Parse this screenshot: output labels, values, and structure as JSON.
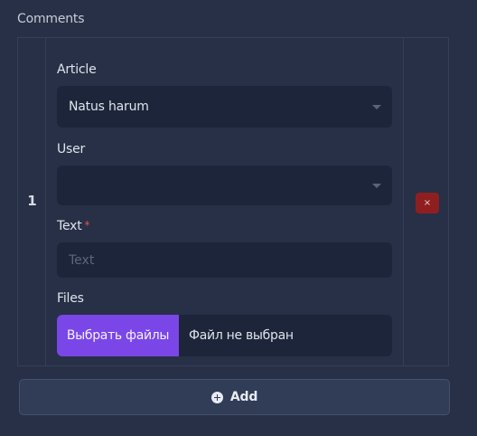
{
  "section": {
    "title": "Comments"
  },
  "row": {
    "index": "1",
    "article": {
      "label": "Article",
      "value": "Natus harum"
    },
    "user": {
      "label": "User",
      "value": ""
    },
    "text": {
      "label": "Text",
      "required_mark": "*",
      "placeholder": "Text",
      "value": ""
    },
    "files": {
      "label": "Files",
      "button_label": "Выбрать файлы",
      "status": "Файл не выбран"
    },
    "delete_label": "×"
  },
  "add_button": {
    "label": "Add",
    "icon": "plus-circle-icon"
  },
  "colors": {
    "background": "#273046",
    "field_background": "#1c2539",
    "file_button": "#7a46e8",
    "delete_button": "#8f1f1f",
    "required": "#e05252"
  }
}
